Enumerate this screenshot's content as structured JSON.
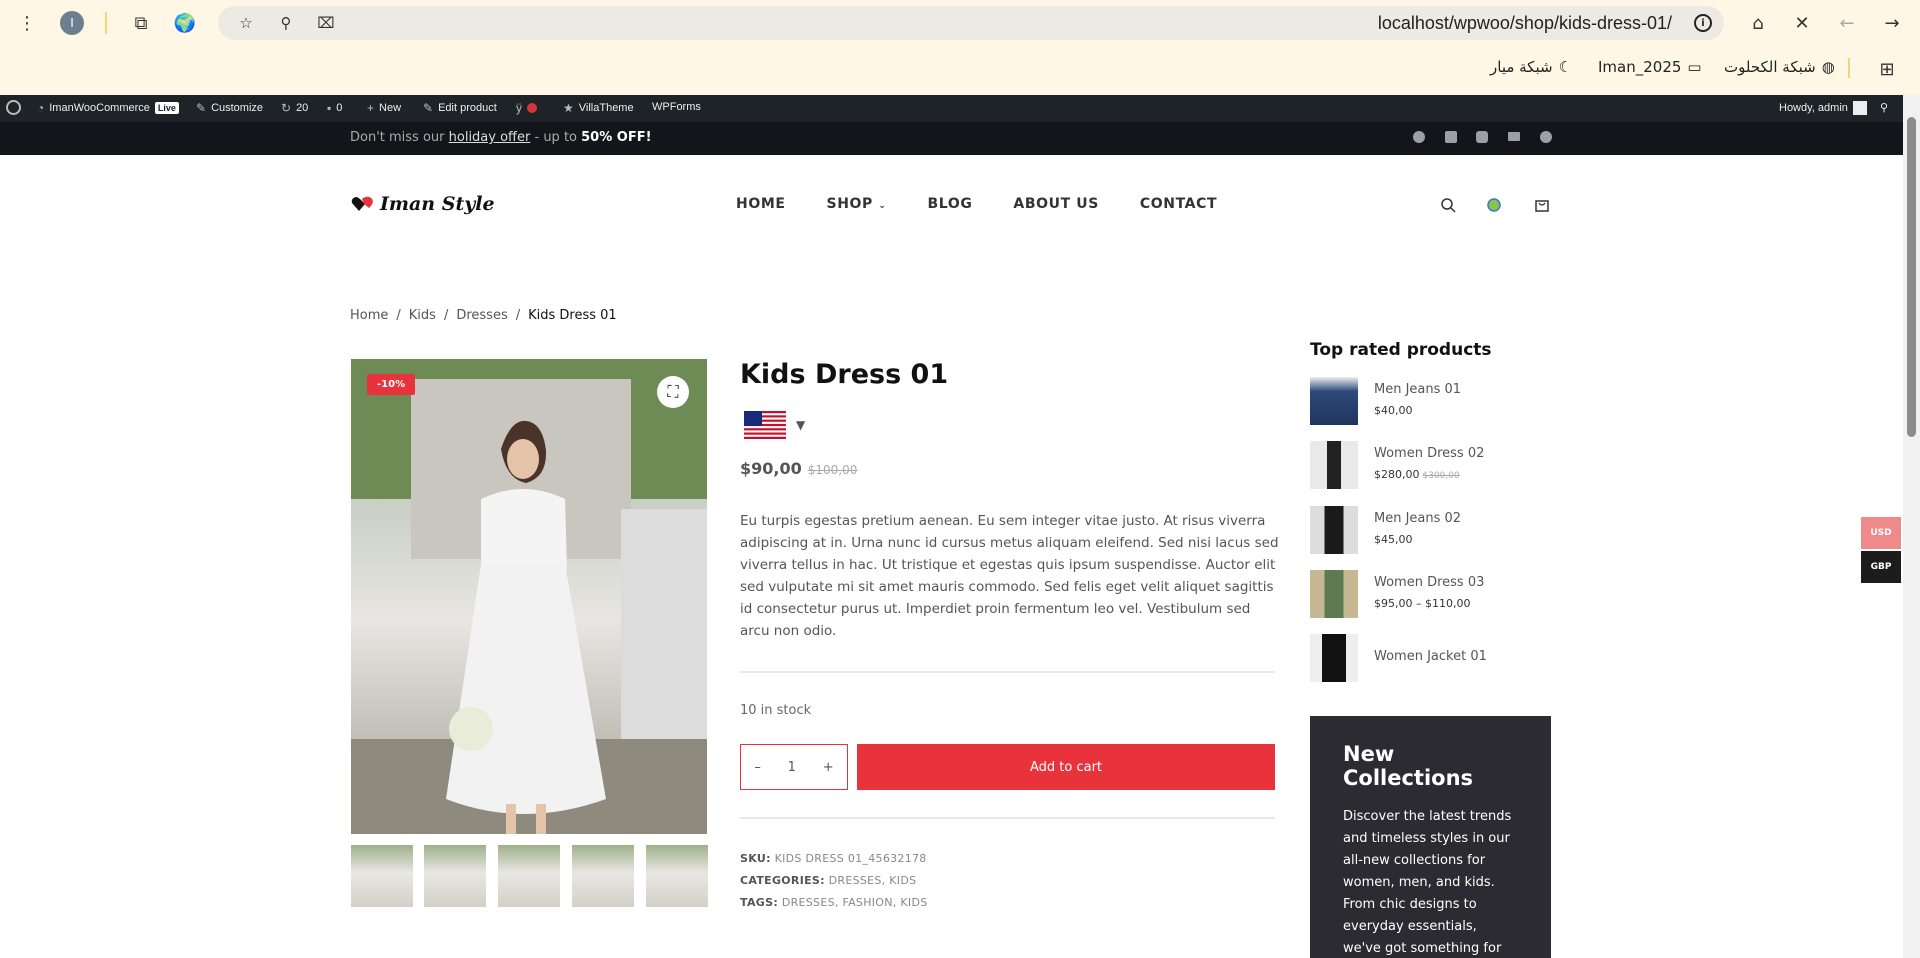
{
  "browser": {
    "profile_initial": "I",
    "url": "localhost/wpwoo/shop/kids-dress-01/",
    "bookmarks": [
      "شبكة الكحلوت",
      "Iman_2025",
      "شبكة ميار"
    ]
  },
  "adminbar": {
    "site": "ImanWooCommerce",
    "live": "Live",
    "customize": "Customize",
    "updates": "20",
    "comments": "0",
    "new": "New",
    "edit": "Edit product",
    "villatheme": "VillaTheme",
    "wpforms": "WPForms",
    "howdy": "Howdy, admin"
  },
  "topbar": {
    "promo_pre": "Don't miss our ",
    "promo_link": "holiday offer",
    "promo_mid": " - up to ",
    "promo_bold": "50% OFF!"
  },
  "header": {
    "logo": "Iman Style",
    "nav": [
      "HOME",
      "SHOP",
      "BLOG",
      "ABOUT US",
      "CONTACT"
    ]
  },
  "breadcrumb": [
    "Home",
    "Kids",
    "Dresses",
    "Kids Dress 01"
  ],
  "product": {
    "badge": "-10%",
    "title": "Kids Dress 01",
    "price": "$90,00",
    "old_price": "$100,00",
    "description": "Eu turpis egestas pretium aenean. Eu sem integer vitae justo. At risus viverra adipiscing at in. Urna nunc id cursus metus aliquam eleifend. Sed nisi lacus sed viverra tellus in hac. Ut tristique et egestas quis ipsum suspendisse. Auctor elit sed vulputate mi sit amet mauris commodo. Sed felis eget velit aliquet sagittis id consectetur purus ut. Imperdiet proin fermentum leo vel. Vestibulum sed arcu non odio.",
    "stock": "10 in stock",
    "qty": "1",
    "add_to_cart": "Add to cart",
    "sku_label": "SKU:",
    "sku": "KIDS DRESS 01_45632178",
    "categories_label": "CATEGORIES:",
    "categories": "DRESSES, KIDS",
    "tags_label": "TAGS:",
    "tags": "DRESSES, FASHION, KIDS"
  },
  "sidebar": {
    "title": "Top rated products",
    "items": [
      {
        "name": "Men Jeans 01",
        "price": "$40,00",
        "old": ""
      },
      {
        "name": "Women Dress 02",
        "price": "$280,00",
        "old": "$300,00"
      },
      {
        "name": "Men Jeans 02",
        "price": "$45,00",
        "old": ""
      },
      {
        "name": "Women Dress 03",
        "price": "$95,00 – $110,00",
        "old": ""
      },
      {
        "name": "Women Jacket 01",
        "price": "",
        "old": ""
      }
    ],
    "promo_title": "New Collections",
    "promo_text": "Discover the latest trends and timeless styles in our all-new collections for women, men, and kids. From chic designs to everyday essentials, we've got something for"
  },
  "currency": [
    "USD",
    "GBP"
  ],
  "colors": {
    "accent": "#e8333d",
    "dark": "#14151a",
    "adminbar": "#1d2327"
  }
}
